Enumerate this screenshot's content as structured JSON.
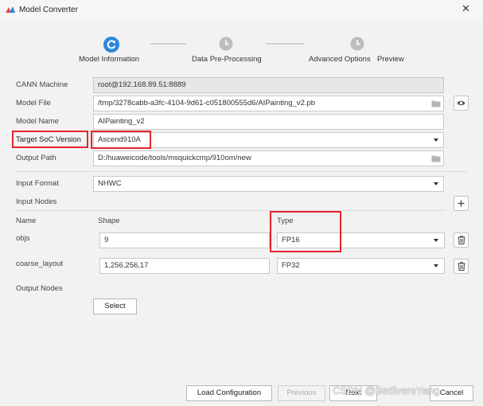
{
  "window": {
    "title": "Model Converter"
  },
  "steps": [
    {
      "label": "Model Information",
      "state": "active"
    },
    {
      "label": "Data Pre-Processing",
      "state": "pending"
    },
    {
      "label": "Advanced Options",
      "state": "pending"
    },
    {
      "label": "Preview",
      "state": "pending"
    }
  ],
  "form": {
    "cann_machine": {
      "label": "CANN Machine",
      "value": "root@192.168.89.51:8889"
    },
    "model_file": {
      "label": "Model File",
      "value": "/tmp/3278cabb-a3fc-4104-9d61-c051800555d6/AIPainting_v2.pb"
    },
    "model_name": {
      "label": "Model Name",
      "value": "AIPainting_v2"
    },
    "target_soc": {
      "label": "Target SoC Version",
      "value": "Ascend910A"
    },
    "output_path": {
      "label": "Output Path",
      "value": "D:/huaweicode/tools/msquickcmp/910om/new"
    },
    "input_format": {
      "label": "Input Format",
      "value": "NHWC"
    }
  },
  "input_nodes": {
    "label": "Input Nodes",
    "headers": {
      "name": "Name",
      "shape": "Shape",
      "type": "Type"
    },
    "rows": [
      {
        "name": "objs",
        "shape": "9",
        "type": "FP16"
      },
      {
        "name": "coarse_layout",
        "shape": "1,256,256,17",
        "type": "FP32"
      }
    ]
  },
  "output_nodes": {
    "label": "Output Nodes",
    "select_label": "Select"
  },
  "footer": {
    "load_config": "Load Configuration",
    "previous": "Previous",
    "next": "Next",
    "cancel": "Cancel"
  },
  "watermark": "CSDN @BedivereYang",
  "colors": {
    "accent": "#2d86e0",
    "highlight": "#e3252b",
    "pending_step": "#bdbdbd"
  }
}
